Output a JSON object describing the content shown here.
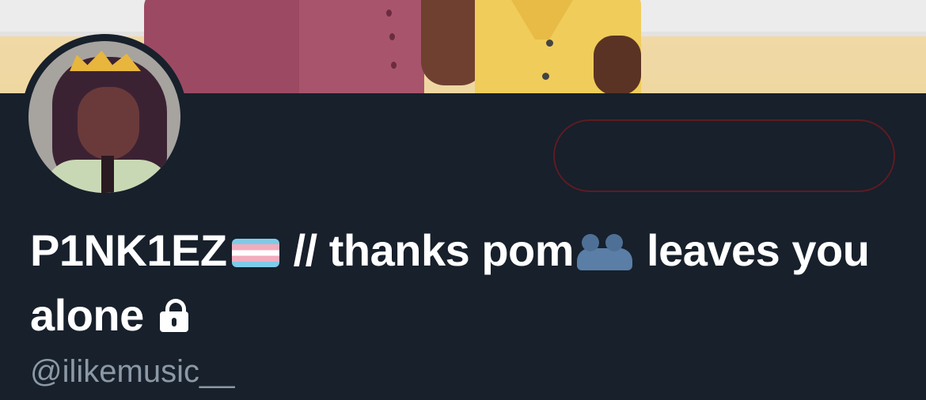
{
  "profile": {
    "display_name_part1": "P1NK1EZ",
    "display_name_part2": "// thanks pom",
    "display_name_part3": "leaves you alone",
    "handle": "@ilikemusic__",
    "protected": true
  },
  "icons": {
    "flag": "transgender-flag-icon",
    "hug": "people-hugging-icon",
    "lock": "lock-icon"
  },
  "colors": {
    "background": "#17202b",
    "name_text": "#ffffff",
    "handle_text": "#8b98a5",
    "button_outline": "#5e1b22"
  }
}
